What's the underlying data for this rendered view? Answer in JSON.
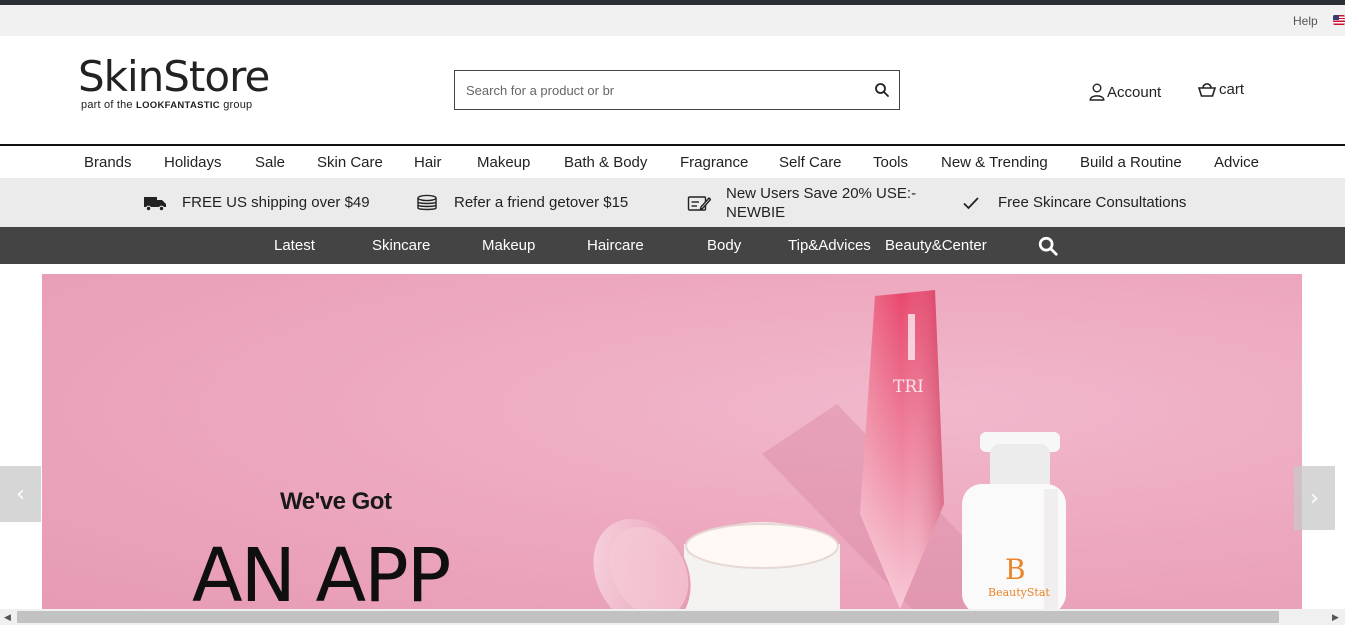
{
  "utility": {
    "help_label": "Help",
    "flag_icon": "us-flag-icon"
  },
  "header": {
    "logo_main": "SkinStore",
    "logo_sub_pre": "part of the ",
    "logo_sub_brand": "LOOKFANTASTIC",
    "logo_sub_post": " group",
    "search_placeholder": "Search for a product or br",
    "search_value": "",
    "account_label": "Account",
    "cart_label": "cart"
  },
  "nav": {
    "items": [
      "Brands",
      "Holidays",
      "Sale",
      "Skin Care",
      "Hair",
      "Makeup",
      "Bath & Body",
      "Fragrance",
      "Self Care",
      "Tools",
      "New & Trending",
      "Build a Routine",
      "Advice"
    ]
  },
  "usp": {
    "shipping": "FREE US shipping over $49",
    "refer": "Refer a friend getover $15",
    "new_users_line1": "New Users Save 20% USE:-",
    "new_users_line2": "NEWBIE",
    "consult": "Free Skincare Consultations"
  },
  "subnav": {
    "items": [
      "Latest",
      "Skincare",
      "Makeup",
      "Haircare",
      "Body",
      "Tip&Advices",
      "Beauty&Center"
    ]
  },
  "hero": {
    "subtitle": "We've Got",
    "title": "AN APP",
    "bottle_brand": "TRI",
    "jar_brand": "B",
    "jar_name": "BeautyStat"
  },
  "carousel": {
    "prev": "‹",
    "next": "›"
  },
  "colors": {
    "subnav_bg": "#444444",
    "usp_bg": "#ebebeb",
    "hero_bg": "#eda9c0",
    "accent_orange": "#e9852a"
  }
}
